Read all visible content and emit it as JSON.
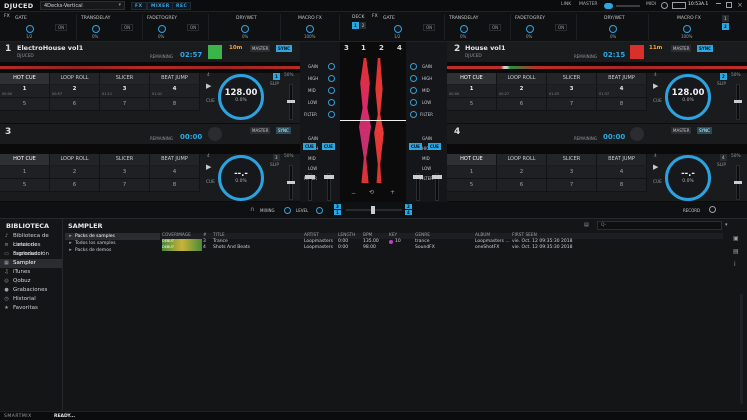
{
  "app": {
    "logo": "DJUCED",
    "layout": "4Decks-Vertical"
  },
  "top_buttons": [
    "FX",
    "MIXER",
    "REC"
  ],
  "top_right": {
    "link": "LINK",
    "master": "MASTER",
    "midi": "MIDI",
    "clock": "10:53A.1"
  },
  "fx_units": [
    {
      "side": "left",
      "fx_label": "FX",
      "slots": [
        {
          "name": "GATE",
          "value": "1/2",
          "on": "ON"
        },
        {
          "name": "TRANSDELAY",
          "value": "0%",
          "on": "ON"
        },
        {
          "name": "FADETOGREY",
          "value": "0%",
          "on": "ON"
        }
      ],
      "drywet_label": "DRY/WET",
      "drywet_value": "0%"
    },
    {
      "side": "right",
      "fx_label": "FX",
      "slots": [
        {
          "name": "GATE",
          "value": "1/2",
          "on": "ON"
        },
        {
          "name": "TRANSDELAY",
          "value": "0%",
          "on": "ON"
        },
        {
          "name": "FADETOGREY",
          "value": "0%",
          "on": "ON"
        }
      ],
      "drywet_label": "DRY/WET",
      "drywet_value": "0%"
    }
  ],
  "macro_fx": {
    "left_label": "MACRO FX",
    "left_value": "100%",
    "deck_label": "DECK",
    "right_label": "MACRO FX",
    "right_value": "100%"
  },
  "decks": [
    {
      "num": "1",
      "title": "ElectroHouse vol1",
      "artist": "DJUCED",
      "time": "02:57",
      "remaining_label": "REMAINING",
      "key": "10m",
      "master": "MASTER",
      "sync": "SYNC",
      "bpm": "128.00",
      "pitch": "0.0%",
      "tab": "HOT CUE",
      "pads": [
        {
          "n": "1",
          "t": "00:00"
        },
        {
          "n": "2",
          "t": "00:57"
        },
        {
          "n": "3",
          "t": "01:11"
        },
        {
          "n": "4",
          "t": "01:41"
        },
        {
          "n": "5"
        },
        {
          "n": "6"
        },
        {
          "n": "7"
        },
        {
          "n": "8"
        }
      ]
    },
    {
      "num": "2",
      "title": "House vol1",
      "artist": "DJUCED",
      "time": "02:15",
      "remaining_label": "REMAINING",
      "key": "11m",
      "master": "MASTER",
      "sync": "SYNC",
      "bpm": "128.00",
      "pitch": "0.0%",
      "tab": "HOT CUE",
      "pads": [
        {
          "n": "1",
          "t": "00:00"
        },
        {
          "n": "2",
          "t": "00:27"
        },
        {
          "n": "3",
          "t": "01:03"
        },
        {
          "n": "4",
          "t": "01:37"
        },
        {
          "n": "5"
        },
        {
          "n": "6"
        },
        {
          "n": "7"
        },
        {
          "n": "8"
        }
      ]
    },
    {
      "num": "3",
      "title": "",
      "artist": "",
      "time": "00:00",
      "remaining_label": "REMAINING",
      "master": "MASTER",
      "sync": "SYNC",
      "bpm": "--.-",
      "pitch": "0.0%",
      "tab": "HOT CUE",
      "pads": [
        {
          "n": "1"
        },
        {
          "n": "2"
        },
        {
          "n": "3"
        },
        {
          "n": "4"
        },
        {
          "n": "5"
        },
        {
          "n": "6"
        },
        {
          "n": "7"
        },
        {
          "n": "8"
        }
      ]
    },
    {
      "num": "4",
      "title": "",
      "artist": "",
      "time": "00:00",
      "remaining_label": "REMAINING",
      "master": "MASTER",
      "sync": "SYNC",
      "bpm": "--.-",
      "pitch": "0.0%",
      "tab": "HOT CUE",
      "pads": [
        {
          "n": "1"
        },
        {
          "n": "2"
        },
        {
          "n": "3"
        },
        {
          "n": "4"
        },
        {
          "n": "5"
        },
        {
          "n": "6"
        },
        {
          "n": "7"
        },
        {
          "n": "8"
        }
      ]
    }
  ],
  "pad_tabs": [
    "HOT CUE",
    "LOOP ROLL",
    "SLICER",
    "BEAT JUMP"
  ],
  "deck_controls": {
    "cue": "CUE",
    "slip": "SLIP",
    "pitch_range": "50%",
    "beat": "4"
  },
  "mixer": {
    "gain": "GAIN",
    "high": "HIGH",
    "mid": "MID",
    "low": "LOW",
    "filter": "FILTER",
    "cue": "CUE",
    "deck_order": [
      "3",
      "1",
      "2",
      "4"
    ]
  },
  "bottom_bar": {
    "mixing": "MIXING",
    "level": "LEVEL",
    "record": "RECORD"
  },
  "sidebar": {
    "title": "BIBLIOTECA",
    "items": [
      {
        "label": "Biblioteca de canciones",
        "icon": "music-note-icon"
      },
      {
        "label": "Listas de reproducción",
        "icon": "playlist-icon"
      },
      {
        "label": "Explorador",
        "icon": "folder-icon"
      },
      {
        "label": "Sampler",
        "icon": "sampler-icon",
        "selected": true
      },
      {
        "label": "iTunes",
        "icon": "itunes-icon"
      },
      {
        "label": "Qobuz",
        "icon": "qobuz-icon"
      },
      {
        "label": "Grabaciones",
        "icon": "mic-icon"
      },
      {
        "label": "Historial",
        "icon": "history-icon"
      },
      {
        "label": "Favoritas",
        "icon": "star-icon"
      }
    ]
  },
  "sampler": {
    "title": "SAMPLER",
    "search_placeholder": "Q-",
    "folders": [
      {
        "label": "Packs de samples",
        "selected": true
      },
      {
        "label": "Todos los samples"
      },
      {
        "label": "Packs de demos"
      }
    ]
  },
  "table": {
    "headers": [
      "COVERIMAGE",
      "#",
      "TITLE",
      "ARTIST",
      "LENGTH",
      "BPM",
      "KEY",
      "GENRE",
      "ALBUM",
      "FIRST SEEN"
    ],
    "rows": [
      {
        "cover": "DEBUT",
        "num": "3",
        "title": "Trance",
        "artist": "Loopmasters",
        "length": "0:00",
        "bpm": "135.00",
        "key": "10",
        "genre": "trance",
        "album": "Loopmasters ...",
        "first_seen": "vie. Oct. 12 09:35:30 2018"
      },
      {
        "cover": "DEBUT",
        "num": "4",
        "title": "Shots And Beats",
        "artist": "Loopmasters",
        "length": "0:00",
        "bpm": "98.00",
        "key": "",
        "genre": "SoundFX",
        "album": "oneShotFX",
        "first_seen": "vie. Oct. 12 09:35:30 2018"
      }
    ]
  },
  "status": {
    "brand": "SMARTMIX",
    "text": "READY..."
  },
  "colors": {
    "accent": "#2aa8e3",
    "waveform": "#e0322e",
    "key_green": "#3bb54a",
    "key_red": "#d9302c"
  }
}
